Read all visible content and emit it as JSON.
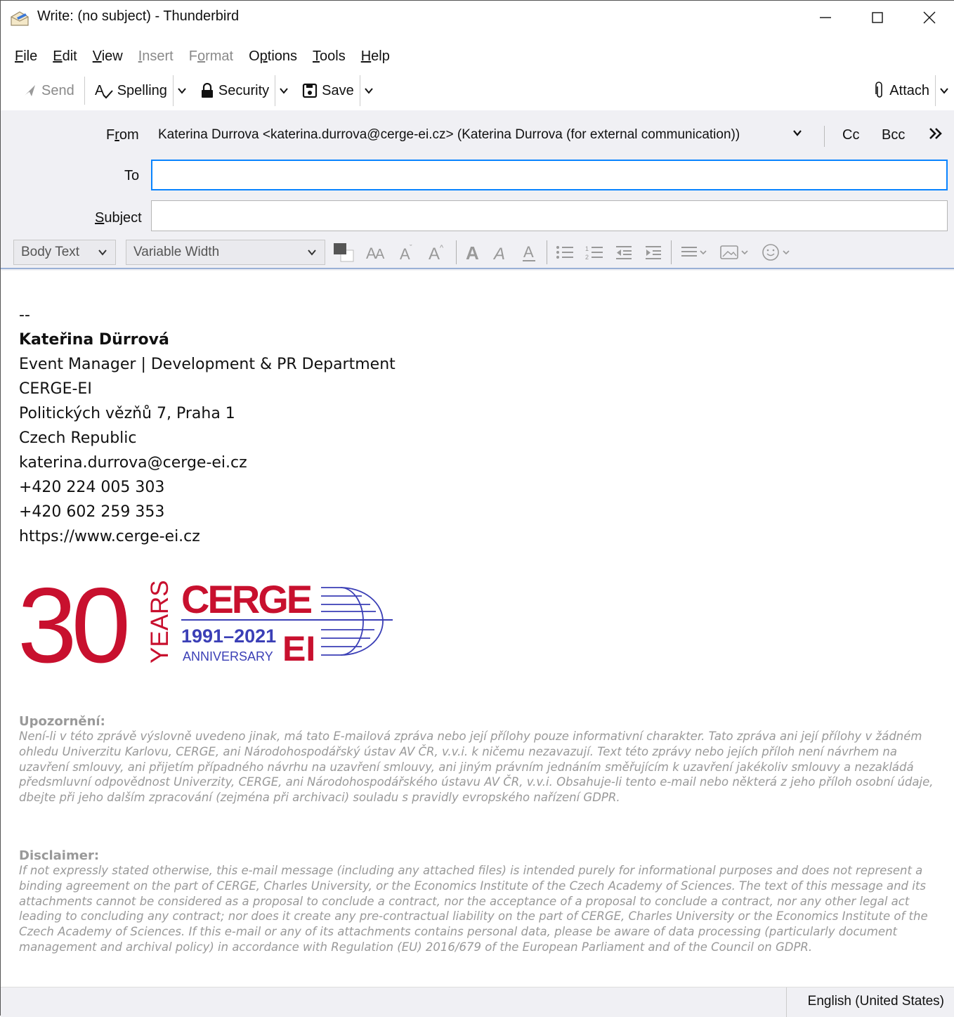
{
  "window": {
    "title": "Write: (no subject) - Thunderbird"
  },
  "menu": {
    "items": [
      {
        "pre": "",
        "key": "F",
        "post": "ile",
        "enabled": true
      },
      {
        "pre": "",
        "key": "E",
        "post": "dit",
        "enabled": true
      },
      {
        "pre": "",
        "key": "V",
        "post": "iew",
        "enabled": true
      },
      {
        "pre": "",
        "key": "I",
        "post": "nsert",
        "enabled": false
      },
      {
        "pre": "F",
        "key": "o",
        "post": "rmat",
        "enabled": false
      },
      {
        "pre": "O",
        "key": "p",
        "post": "tions",
        "enabled": true
      },
      {
        "pre": "",
        "key": "T",
        "post": "ools",
        "enabled": true
      },
      {
        "pre": "",
        "key": "H",
        "post": "elp",
        "enabled": true
      }
    ]
  },
  "toolbar": {
    "send": "Send",
    "spelling": "Spelling",
    "security": "Security",
    "save": "Save",
    "attach": "Attach"
  },
  "header": {
    "from_label_pre": "F",
    "from_label_key": "r",
    "from_label_post": "om",
    "from_value": "Katerina Durrova <katerina.durrova@cerge-ei.cz> (Katerina Durrova (for external communication))",
    "cc": "Cc",
    "bcc": "Bcc",
    "to_label": "To",
    "to_value": "",
    "subject_label_key": "S",
    "subject_label_post": "ubject",
    "subject_value": ""
  },
  "format": {
    "paragraph": "Body Text",
    "font": "Variable Width"
  },
  "signature": {
    "dashes": "--",
    "name": "Kateřina Dürrová",
    "lines": [
      "Event Manager | Development & PR Department",
      "CERGE-EI",
      "Politických vězňů 7, Praha 1",
      "Czech Republic",
      "katerina.durrova@cerge-ei.cz",
      "+420 224 005 303",
      "+420 602 259 353",
      "https://www.cerge-ei.cz"
    ]
  },
  "logo": {
    "number": "30",
    "years": "YEARS",
    "cerge": "CERGE",
    "dates": "1991–2021",
    "anniversary": "ANNIVERSARY",
    "ei": "EI",
    "red": "#c8102e",
    "blue": "#3b3fb6"
  },
  "disclaimer_cz": {
    "title": "Upozornění:",
    "text": "Není-li v této zprávě výslovně uvedeno jinak, má tato E-mailová zpráva nebo její přílohy pouze informativní charakter. Tato zpráva ani její přílohy v žádném ohledu Univerzitu Karlovu, CERGE, ani Národohospodářský ústav AV ČR, v.v.i. k ničemu nezavazují. Text této zprávy nebo jejích příloh není návrhem na uzavření smlouvy, ani přijetím případného návrhu na uzavření smlouvy, ani jiným právním jednáním směřujícím k uzavření jakékoliv smlouvy a nezakládá předsmluvní odpovědnost Univerzity, CERGE, ani Národohospodářského ústavu AV ČR, v.v.i. Obsahuje-li tento e-mail nebo některá z jeho příloh osobní údaje, dbejte při jeho dalším zpracování (zejména při archivaci) souladu s pravidly evropského nařízení GDPR."
  },
  "disclaimer_en": {
    "title": "Disclaimer:",
    "text": "If not expressly stated otherwise, this e-mail message (including any attached files) is intended purely for informational purposes and does not represent a binding agreement on the part of CERGE, Charles University, or the Economics Institute of the Czech Academy of Sciences. The text of this message and its attachments cannot be considered as a proposal to conclude a contract, nor the acceptance of a proposal to conclude a contract, nor any other legal act leading to concluding any contract; nor does it create any pre-contractual liability on the part of CERGE, Charles University or the Economics Institute of the Czech Academy of Sciences. If this e-mail or any of its attachments contains personal data, please be aware of data processing (particularly document management and archival policy) in accordance with Regulation (EU) 2016/679 of the European Parliament and of the Council on GDPR."
  },
  "status": {
    "language": "English (United States)"
  }
}
